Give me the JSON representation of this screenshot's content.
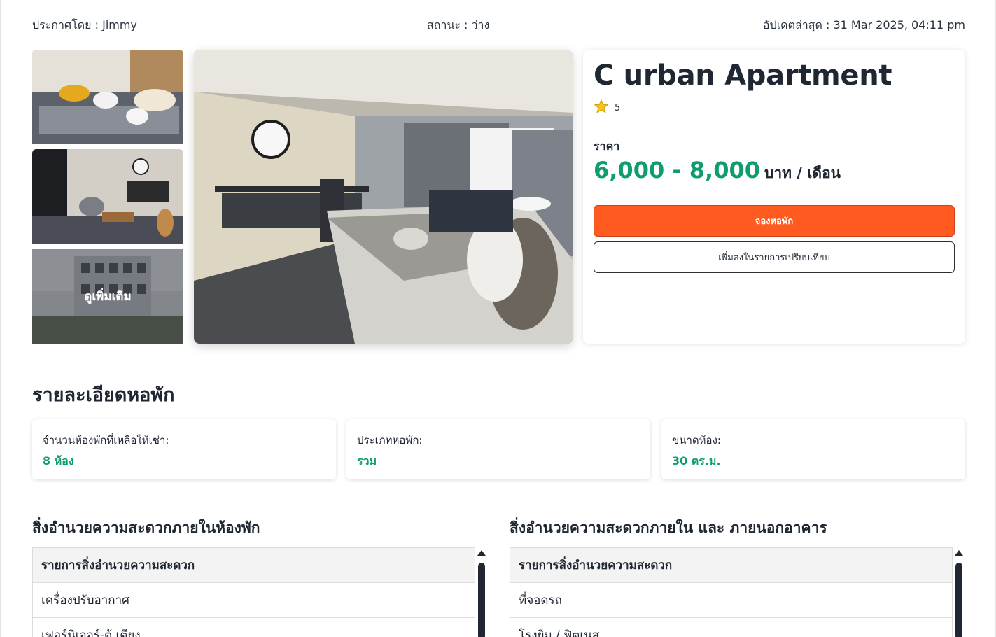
{
  "header": {
    "posted_by": "ประกาศโดย : Jimmy",
    "status": "สถานะ : ว่าง",
    "updated": "อัปเดตล่าสุด : 31 Mar 2025, 04:11 pm"
  },
  "gallery": {
    "see_more": "ดูเพิ่มเติม"
  },
  "listing": {
    "name": "C urban Apartment",
    "rating": "5",
    "price_label": "ราคา",
    "price": "6,000 - 8,000",
    "price_unit": "บาท / เดือน",
    "book_button": "จองหอพัก",
    "compare_button": "เพิ่มลงในรายการเปรียบเทียบ"
  },
  "details": {
    "title": "รายละเอียดหอพัก",
    "stats": [
      {
        "label": "จำนวนห้องพักที่เหลือให้เช่า:",
        "value": "8 ห้อง"
      },
      {
        "label": "ประเภทหอพัก:",
        "value": "รวม"
      },
      {
        "label": "ขนาดห้อง:",
        "value": "30 ตร.ม."
      }
    ]
  },
  "facilities": {
    "in_room": {
      "title": "สิ่งอำนวยความสะดวกภายในห้องพัก",
      "header": "รายการสิ่งอำนวยความสะดวก",
      "rows": [
        "เครื่องปรับอากาศ",
        "เฟอร์นิเจอร์-ตู้ เตียง"
      ]
    },
    "building": {
      "title": "สิ่งอำนวยความสะดวกภายใน และ ภายนอกอาคาร",
      "header": "รายการสิ่งอำนวยความสะดวก",
      "rows": [
        "ที่จอดรถ",
        "โรงยิม / ฟิตเนส"
      ]
    }
  },
  "colors": {
    "accent_green": "#0f9d6e",
    "book_orange": "#ff5a1f",
    "star": "#f5c518"
  },
  "icons": {
    "rating": "star-icon"
  }
}
